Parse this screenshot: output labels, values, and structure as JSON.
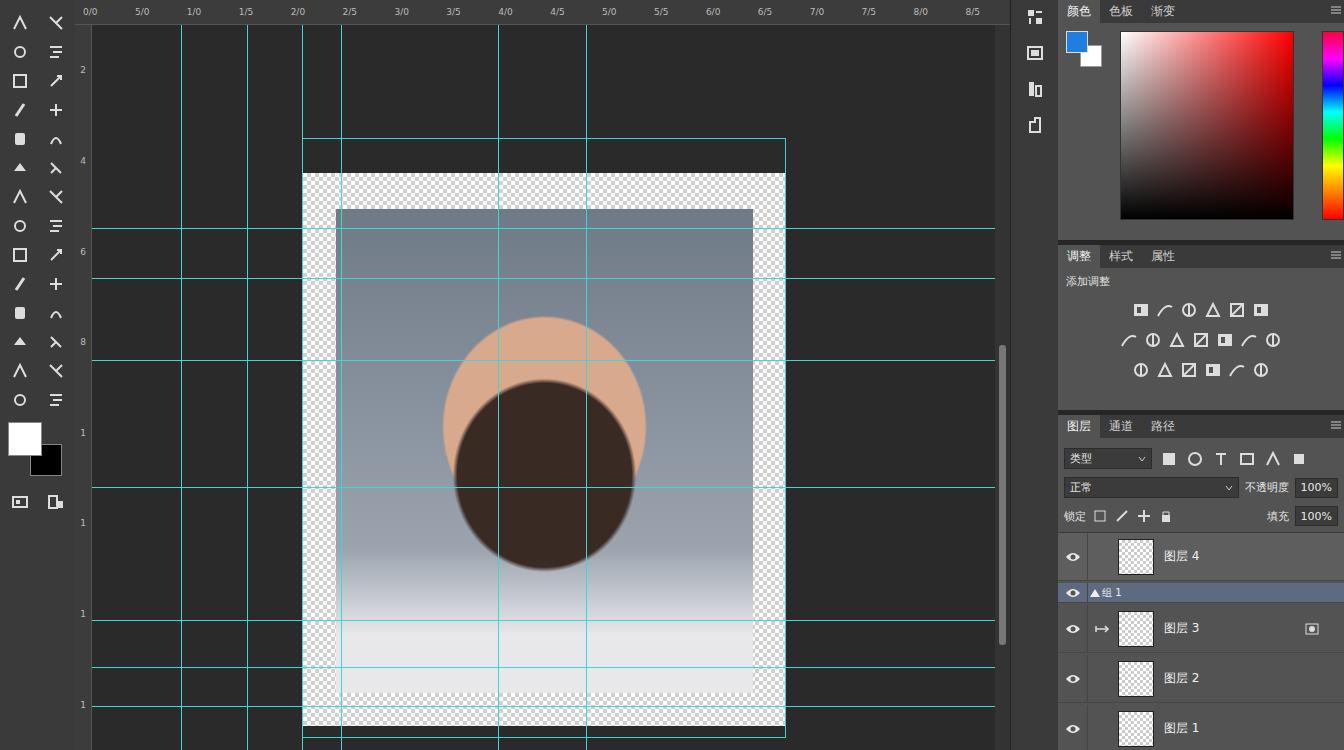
{
  "rulers": {
    "top": [
      "0/0",
      "5/0",
      "1/0",
      "1/5",
      "2/0",
      "2/5",
      "3/0",
      "3/5",
      "4/0",
      "4/5",
      "5/0",
      "5/5",
      "6/0",
      "6/5",
      "7/0",
      "7/5",
      "8/0",
      "8/5"
    ],
    "left": [
      "2",
      "4",
      "6",
      "8",
      "1",
      "1",
      "1",
      "1"
    ]
  },
  "toolbar": {
    "foreground": "#ffffff",
    "background": "#000000"
  },
  "color_panel": {
    "tabs": [
      {
        "label": "颜色",
        "selected": true
      },
      {
        "label": "色板",
        "selected": false
      },
      {
        "label": "渐变",
        "selected": false
      }
    ],
    "foreground": "#1e7fe0",
    "background": "#ffffff"
  },
  "adjustments_panel": {
    "tabs": [
      {
        "label": "调整",
        "selected": true
      },
      {
        "label": "样式",
        "selected": false
      },
      {
        "label": "属性",
        "selected": false
      }
    ],
    "title": "添加调整"
  },
  "layers_panel": {
    "tabs": [
      {
        "label": "图层",
        "selected": true
      },
      {
        "label": "通道",
        "selected": false
      },
      {
        "label": "路径",
        "selected": false
      }
    ],
    "filter": "类型",
    "blend_mode": "正常",
    "opacity_label": "不透明度",
    "opacity": "100%",
    "lock_label": "锁定",
    "fill_label": "填充",
    "fill": "100%",
    "layers": [
      {
        "name": "图层 4",
        "kind": "layer",
        "visible": true,
        "selected": false
      },
      {
        "name": "组 1",
        "kind": "group",
        "visible": true,
        "selected": true
      },
      {
        "name": "图层 3",
        "kind": "clipped",
        "visible": true,
        "selected": false
      },
      {
        "name": "图层 2",
        "kind": "layer",
        "visible": true,
        "selected": false
      },
      {
        "name": "图层 1",
        "kind": "layer",
        "visible": true,
        "selected": false
      }
    ]
  }
}
